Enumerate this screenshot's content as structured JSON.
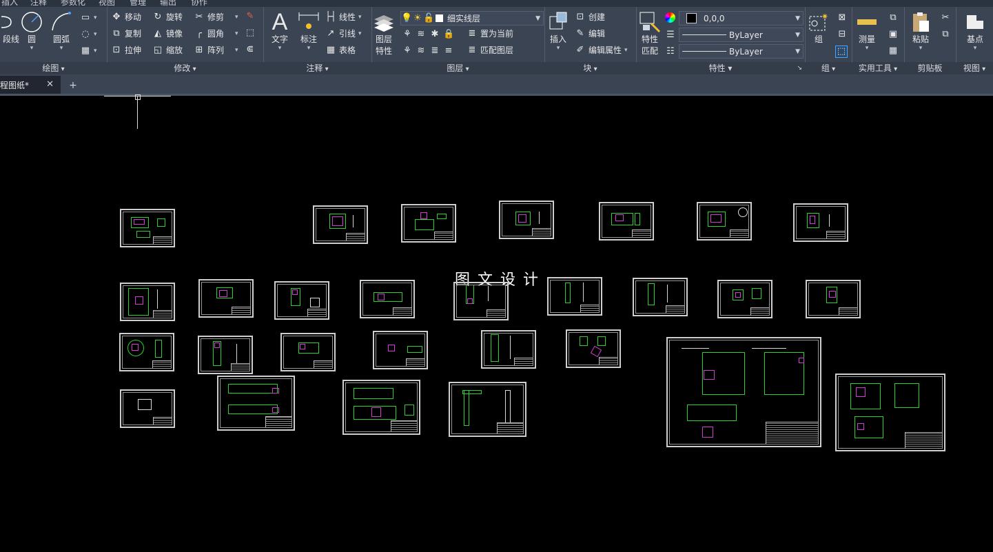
{
  "menubar": {
    "items": [
      "插入",
      "注释",
      "参数化",
      "视图",
      "管理",
      "输出",
      "协作"
    ]
  },
  "ribbon": {
    "draw": {
      "title": "绘图",
      "polyline": "段线",
      "circle": "圆",
      "arc": "圆弧"
    },
    "modify": {
      "title": "修改",
      "move": "移动",
      "rotate": "旋转",
      "trim": "修剪",
      "copy": "复制",
      "mirror": "镜像",
      "fillet": "圆角",
      "stretch": "拉伸",
      "scale": "缩放",
      "array": "阵列"
    },
    "annotation": {
      "title": "注释",
      "text": "文字",
      "dimension": "标注",
      "linear": "线性",
      "leader": "引线",
      "table": "表格"
    },
    "layers": {
      "title": "图层",
      "properties_line1": "图层",
      "properties_line2": "特性",
      "current_layer": "细实线层",
      "set_current": "置为当前",
      "match_layer": "匹配图层"
    },
    "block": {
      "title": "块",
      "insert": "插入",
      "create": "创建",
      "edit": "编辑",
      "edit_attributes": "编辑属性"
    },
    "properties": {
      "title": "特性",
      "match_line1": "特性",
      "match_line2": "匹配",
      "color_value": "0,0,0",
      "linetype": "ByLayer",
      "lineweight": "ByLayer"
    },
    "groups": {
      "title": "组",
      "group": "组"
    },
    "utilities": {
      "title": "实用工具",
      "measure": "测量"
    },
    "clipboard": {
      "title": "剪贴板",
      "paste": "粘贴"
    },
    "view": {
      "title": "视图",
      "base": "基点"
    }
  },
  "tabs": {
    "document": "程图纸*",
    "new_tab": "+"
  },
  "canvas": {
    "watermark": "图文设计"
  }
}
